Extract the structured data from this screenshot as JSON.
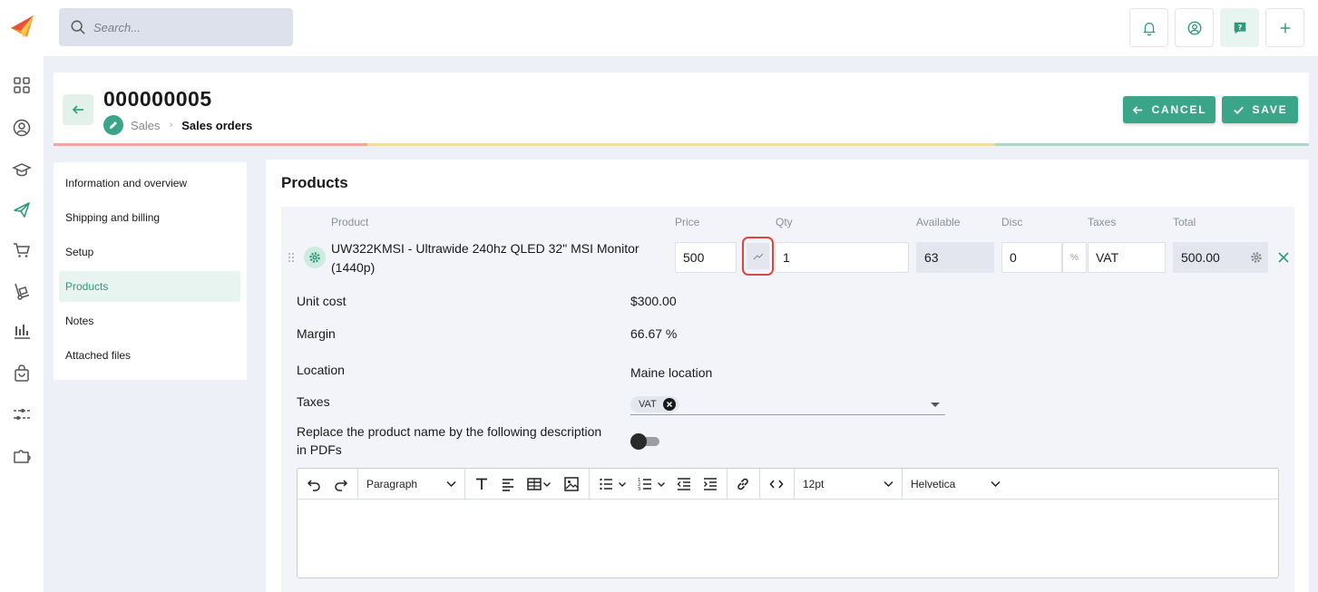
{
  "search": {
    "placeholder": "Search..."
  },
  "header": {
    "order_number": "000000005",
    "breadcrumb": [
      "Sales",
      "Sales orders"
    ],
    "cancel_label": "CANCEL",
    "save_label": "SAVE",
    "strip_colors": [
      "#f2a697",
      "#f6dc9a",
      "#a6d9c8"
    ]
  },
  "colors": {
    "accent": "#3ba58a",
    "highlight": "#d9473a"
  },
  "sidenav": {
    "items": [
      {
        "label": "Information and overview",
        "active": false
      },
      {
        "label": "Shipping and billing",
        "active": false
      },
      {
        "label": "Setup",
        "active": false
      },
      {
        "label": "Products",
        "active": true
      },
      {
        "label": "Notes",
        "active": false
      },
      {
        "label": "Attached files",
        "active": false
      }
    ]
  },
  "products": {
    "title": "Products",
    "columns": [
      "Product",
      "Price",
      "Qty",
      "Available",
      "Disc",
      "Taxes",
      "Total"
    ],
    "row": {
      "name": "UW322KMSI - Ultrawide 240hz QLED 32\" MSI Monitor (1440p)",
      "price": "500",
      "qty": "1",
      "available": "63",
      "disc": "0",
      "disc_unit": "%",
      "taxes": "VAT",
      "total": "500.00"
    },
    "details": {
      "unit_cost_label": "Unit cost",
      "unit_cost": "$300.00",
      "margin_label": "Margin",
      "margin": "66.67 %",
      "location_label": "Location",
      "location": "Maine location",
      "taxes_label": "Taxes",
      "tax_chip": "VAT",
      "replace_label": "Replace the product name by the following description in PDFs",
      "replace_enabled": false
    },
    "editor": {
      "block_format": "Paragraph",
      "font_size": "12pt",
      "font_family": "Helvetica"
    }
  }
}
